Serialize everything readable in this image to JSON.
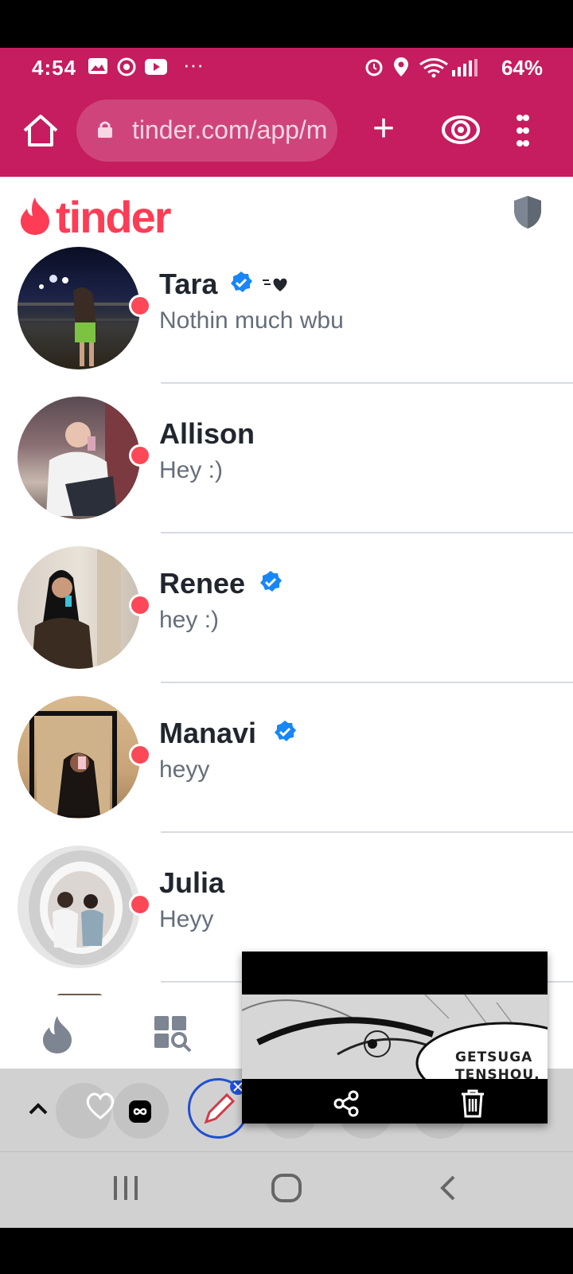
{
  "status_bar": {
    "time": "4:54",
    "battery": "64%"
  },
  "browser": {
    "url": "tinder.com/app/m"
  },
  "app": {
    "logo_text": "tinder"
  },
  "matches": [
    {
      "name": "Tara",
      "message": "Nothin much wbu",
      "verified": true,
      "super_like": true
    },
    {
      "name": "Allison",
      "message": "Hey :)",
      "verified": false
    },
    {
      "name": "Renee",
      "message": "hey :)",
      "verified": true
    },
    {
      "name": "Manavi",
      "message": "heyy",
      "verified": true
    },
    {
      "name": "Julia",
      "message": "Heyy",
      "verified": false
    }
  ],
  "screenshot_preview": {
    "caption_line1": "GETSUGA",
    "caption_line2": "TENSHOU."
  },
  "colors": {
    "brand": "#fd3c56",
    "chrome": "#c51d5f",
    "verified": "#1786f8",
    "online_dot": "#fd4858"
  }
}
